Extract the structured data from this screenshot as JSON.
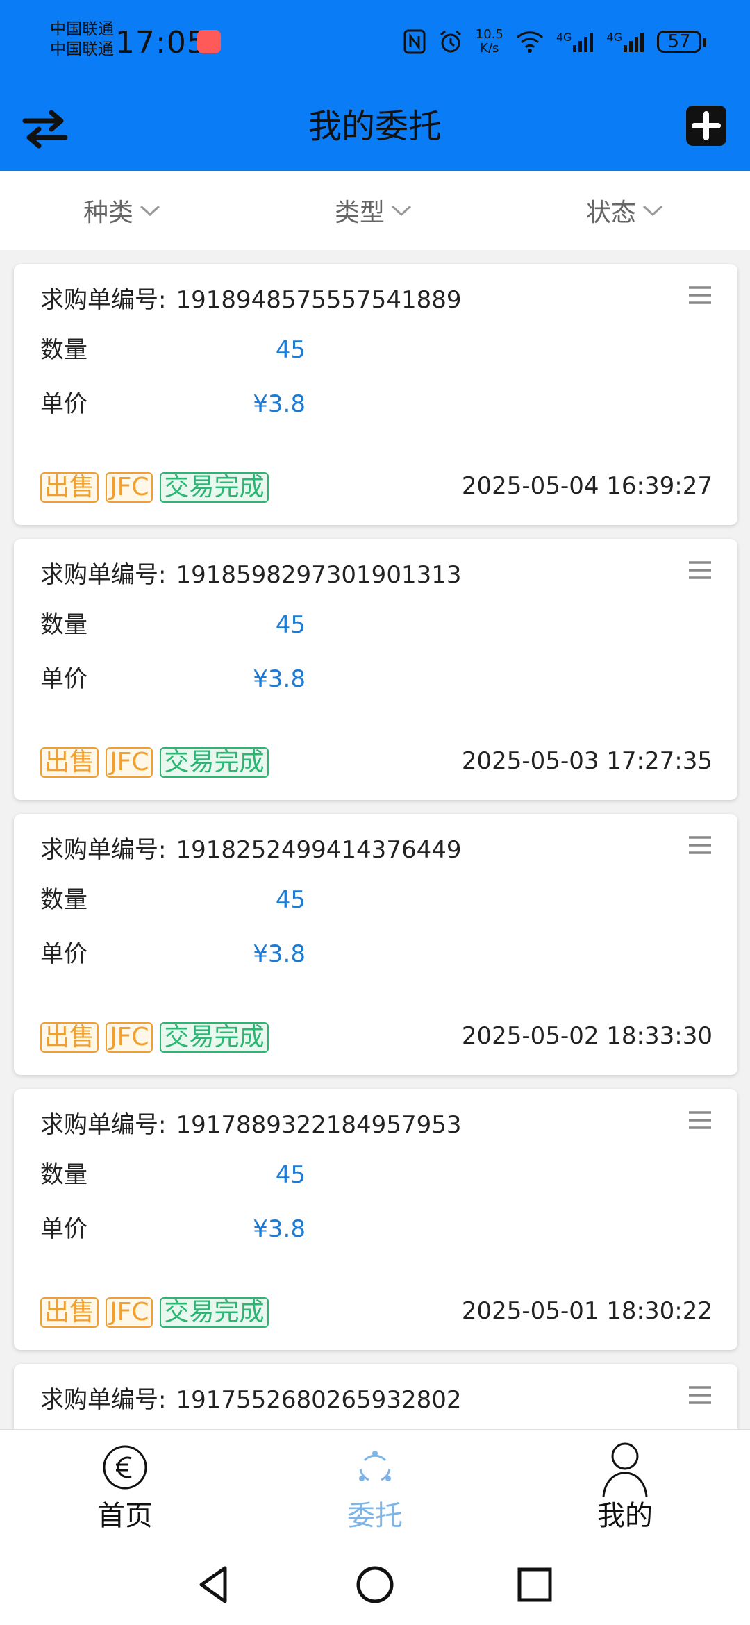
{
  "status_bar": {
    "carrier_1": "中国联通",
    "carrier_2": "中国联通",
    "time": "17:05",
    "net_speed_value": "10.5",
    "net_speed_unit": "K/s",
    "network_1": "4G",
    "network_2": "4G",
    "battery": "57"
  },
  "header": {
    "title": "我的委托",
    "left_icon": "swap-arrows-icon",
    "right_icon": "plus-square-icon"
  },
  "filters": [
    {
      "label": "种类"
    },
    {
      "label": "类型"
    },
    {
      "label": "状态"
    }
  ],
  "cards": [
    {
      "order_label": "求购单编号:",
      "order_no": "1918948575557541889",
      "qty_label": "数量",
      "qty": "45",
      "price_label": "单价",
      "price": "¥3.8",
      "tags": [
        "出售",
        "JFC",
        "交易完成"
      ],
      "time": "2025-05-04 16:39:27"
    },
    {
      "order_label": "求购单编号:",
      "order_no": "1918598297301901313",
      "qty_label": "数量",
      "qty": "45",
      "price_label": "单价",
      "price": "¥3.8",
      "tags": [
        "出售",
        "JFC",
        "交易完成"
      ],
      "time": "2025-05-03 17:27:35"
    },
    {
      "order_label": "求购单编号:",
      "order_no": "1918252499414376449",
      "qty_label": "数量",
      "qty": "45",
      "price_label": "单价",
      "price": "¥3.8",
      "tags": [
        "出售",
        "JFC",
        "交易完成"
      ],
      "time": "2025-05-02 18:33:30"
    },
    {
      "order_label": "求购单编号:",
      "order_no": "1917889322184957953",
      "qty_label": "数量",
      "qty": "45",
      "price_label": "单价",
      "price": "¥3.8",
      "tags": [
        "出售",
        "JFC",
        "交易完成"
      ],
      "time": "2025-05-01 18:30:22"
    },
    {
      "order_label": "求购单编号:",
      "order_no": "1917552680265932802"
    }
  ],
  "tabbar": [
    {
      "label": "首页",
      "icon": "euro-icon",
      "active": false
    },
    {
      "label": "委托",
      "icon": "cycle-icon",
      "active": true
    },
    {
      "label": "我的",
      "icon": "person-icon",
      "active": false
    }
  ],
  "colors": {
    "header_bg": "#0a7df6",
    "value_blue": "#1d7bd3",
    "tag_orange": "#f0a030",
    "tag_green": "#2bb673",
    "tab_active": "#7fb4e6"
  }
}
